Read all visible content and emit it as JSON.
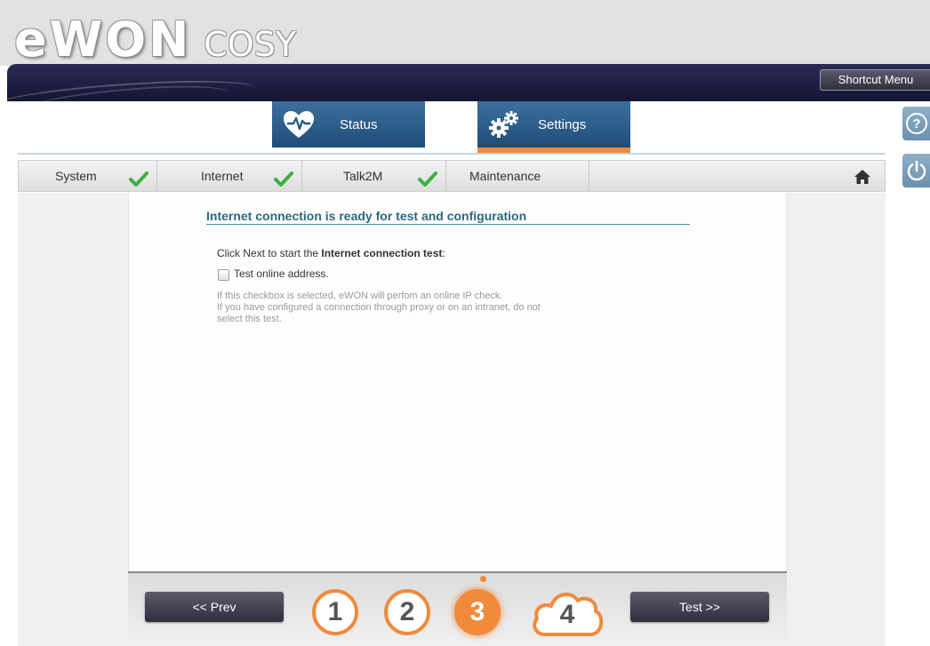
{
  "header": {
    "brand": "eWON",
    "product": "COSY",
    "shortcut_menu": "Shortcut Menu"
  },
  "main_tabs": [
    {
      "label": "Status",
      "icon": "heart-monitor-icon"
    },
    {
      "label": "Settings",
      "icon": "gears-icon",
      "active": true
    }
  ],
  "steps": [
    {
      "label": "System",
      "done": true
    },
    {
      "label": "Internet",
      "done": true
    },
    {
      "label": "Talk2M",
      "done": true
    },
    {
      "label": "Maintenance",
      "done": false
    }
  ],
  "content": {
    "title": "Internet connection is ready for test and configuration",
    "instruction_prefix": "Click Next to start the ",
    "instruction_bold": "Internet connection test",
    "instruction_suffix": ":",
    "checkbox_label": "Test online address.",
    "checkbox_checked": false,
    "help_lines": [
      "If this checkbox is selected, eWON will perfom an online IP check.",
      "If you have configured a connection through proxy or on an intranet, do not",
      "select this test."
    ]
  },
  "nav": {
    "prev": "<< Prev",
    "next": "Test >>",
    "wizard_steps": [
      "1",
      "2",
      "3",
      "4"
    ],
    "current_step": "3"
  },
  "colors": {
    "accent": "#f08a3c",
    "tab_blue": "#2a5d8a",
    "title_teal": "#2c6a7e",
    "check_green": "#3cb043"
  }
}
